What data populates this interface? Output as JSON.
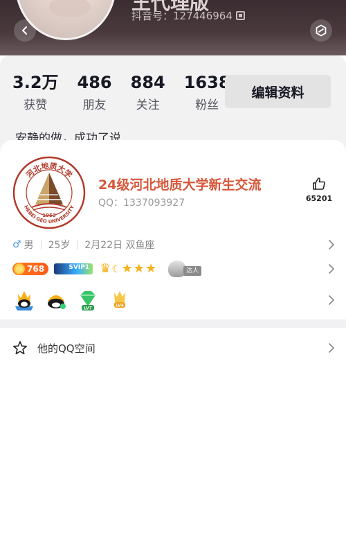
{
  "profile": {
    "username_partial": "王代理版",
    "douyin_id": "抖音号：127446964",
    "bio": "安静的做，成功了说"
  },
  "stats": [
    {
      "value": "3.2万",
      "label": "获赞"
    },
    {
      "value": "486",
      "label": "朋友"
    },
    {
      "value": "884",
      "label": "关注"
    },
    {
      "value": "1638",
      "label": "粉丝"
    }
  ],
  "edit_profile_label": "编辑资料",
  "group_card": {
    "logo_year": "1953",
    "logo_top_text": "河北地质大学",
    "logo_bottom_text": "HEBEI GEO UNIVERSITY",
    "name": "24级河北地质大学新生交流",
    "qq": "QQ：1337093927",
    "like_count": "65201"
  },
  "info_row": {
    "gender_icon": "male-icon",
    "gender": "男",
    "age": "25岁",
    "birthday": "2月22日 双鱼座"
  },
  "badges": {
    "coin_value": "768",
    "daren_label": "达人"
  },
  "qzone": {
    "label": "他的QQ空间"
  },
  "colors": {
    "group_name": "#d6573a",
    "logo_red": "#b23a2a",
    "male_blue": "#4a90e2"
  }
}
